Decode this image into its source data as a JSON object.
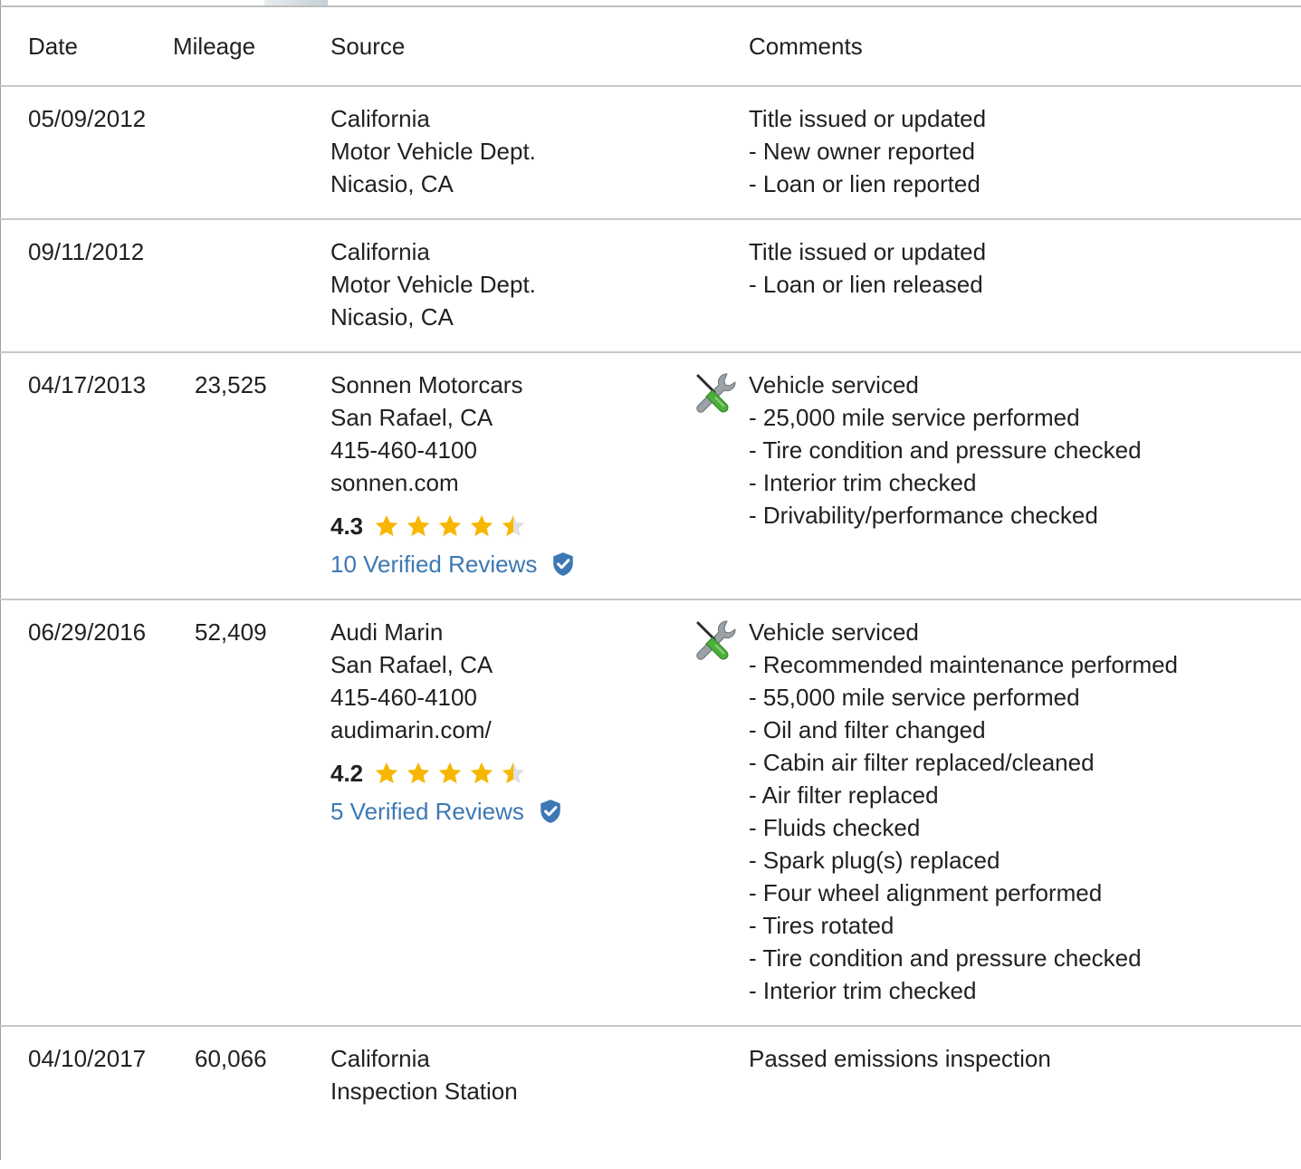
{
  "table": {
    "headers": {
      "date": "Date",
      "mileage": "Mileage",
      "source": "Source",
      "comments": "Comments"
    },
    "rows": [
      {
        "date": "05/09/2012",
        "mileage": "",
        "source": [
          "California",
          "Motor Vehicle Dept.",
          "Nicasio, CA"
        ],
        "icon": "",
        "comment_title": "Title issued or updated",
        "comment_items": [
          "- New owner reported",
          "- Loan or lien reported"
        ]
      },
      {
        "date": "09/11/2012",
        "mileage": "",
        "source": [
          "California",
          "Motor Vehicle Dept.",
          "Nicasio, CA"
        ],
        "icon": "",
        "comment_title": "Title issued or updated",
        "comment_items": [
          "- Loan or lien released"
        ]
      },
      {
        "date": "04/17/2013",
        "mileage": "23,525",
        "source": [
          "Sonnen Motorcars",
          "San Rafael, CA",
          "415-460-4100",
          "sonnen.com"
        ],
        "rating": {
          "value": "4.3",
          "stars": 4.3,
          "reviews": "10 Verified Reviews"
        },
        "icon": "wrench-screwdriver-icon",
        "comment_title": "Vehicle serviced",
        "comment_items": [
          "- 25,000 mile service performed",
          "- Tire condition and pressure checked",
          "- Interior trim checked",
          "- Drivability/performance checked"
        ]
      },
      {
        "date": "06/29/2016",
        "mileage": "52,409",
        "source": [
          "Audi Marin",
          "San Rafael, CA",
          "415-460-4100",
          "audimarin.com/"
        ],
        "rating": {
          "value": "4.2",
          "stars": 4.2,
          "reviews": "5 Verified Reviews"
        },
        "icon": "wrench-screwdriver-icon",
        "comment_title": "Vehicle serviced",
        "comment_items": [
          "- Recommended maintenance performed",
          "- 55,000 mile service performed",
          "- Oil and filter changed",
          "- Cabin air filter replaced/cleaned",
          "- Air filter replaced",
          "- Fluids checked",
          "- Spark plug(s) replaced",
          "- Four wheel alignment performed",
          "- Tires rotated",
          "- Tire condition and pressure checked",
          "- Interior trim checked"
        ]
      },
      {
        "date": "04/10/2017",
        "mileage": "60,066",
        "source": [
          "California",
          "Inspection Station"
        ],
        "icon": "",
        "comment_title": "Passed emissions inspection",
        "comment_items": []
      }
    ]
  },
  "colors": {
    "star_filled": "#f7b600",
    "star_empty": "#e0e0e0",
    "link": "#3c78b4",
    "shield": "#3c78b4",
    "divider": "#c8c8c8"
  }
}
